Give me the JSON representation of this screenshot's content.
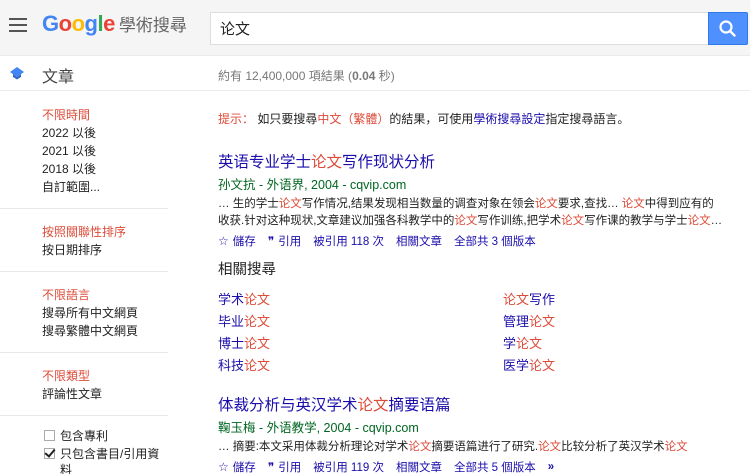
{
  "header": {
    "logo_letters": [
      "G",
      "o",
      "o",
      "g",
      "l",
      "e"
    ],
    "logo_colors": [
      "#4285f4",
      "#ea4335",
      "#fbbc05",
      "#4285f4",
      "#34a853",
      "#ea4335"
    ],
    "product": "學術搜尋",
    "search_value": "论文",
    "search_placeholder": ""
  },
  "subbar": {
    "section": "文章",
    "stats_prefix": "約有 12,400,000 項結果 (",
    "stats_time": "0.04",
    "stats_suffix": " 秒)"
  },
  "sidebar": {
    "time": [
      "不限時間",
      "2022 以後",
      "2021 以後",
      "2018 以後",
      "自訂範圍..."
    ],
    "sort": [
      "按照關聯性排序",
      "按日期排序"
    ],
    "language": [
      "不限語言",
      "搜尋所有中文網頁",
      "搜尋繁體中文網頁"
    ],
    "type": [
      "不限類型",
      "評論性文章"
    ],
    "include_patents": "包含專利",
    "include_citations": "只包含書目/引用資料"
  },
  "tip": {
    "label": "提示：",
    "pre": "如只要搜尋",
    "red": "中文（繁體）",
    "mid": "的結果，可使用",
    "link": "學術搜尋設定",
    "post": "指定搜尋語言。"
  },
  "results": [
    {
      "title_pre": "英语专业学士",
      "title_hl": "论文",
      "title_post": "写作现状分析",
      "meta": "孙文抗 - 外语界, 2004 - cqvip.com",
      "snippet1": [
        "… 生的学士",
        "论文",
        "写作情况,结果发现相当数量的调查对象在领会",
        "论文",
        "要求,查找… ",
        "论文",
        "中得到应有的"
      ],
      "snippet2": [
        "收获.针对这种现状,文章建议加强各科教学中的",
        "论文",
        "写作训练,把学术",
        "论文",
        "写作课的教学与学士",
        "论文",
        "…"
      ],
      "save": "儲存",
      "cite": "引用",
      "cited_by": "被引用 118 次",
      "related": "相關文章",
      "versions": "全部共 3 個版本"
    },
    {
      "title_pre": "体裁分析与英汉学术",
      "title_hl": "论文",
      "title_post": "摘要语篇",
      "meta": "鞠玉梅 - 外语教学, 2004 - cqvip.com",
      "snippet1": [
        "… 摘要:本文采用体裁分析理论对学术",
        "论文",
        "摘要语篇进行了研究.",
        "论文",
        "比较分析了英汉学术",
        "论文",
        ""
      ],
      "snippet2": [],
      "save": "儲存",
      "cite": "引用",
      "cited_by": "被引用 119 次",
      "related": "相關文章",
      "versions": "全部共 5 個版本"
    }
  ],
  "related_searches": {
    "title": "相關搜尋",
    "items": [
      {
        "pre": "学术",
        "hl": "论文",
        "post": ""
      },
      {
        "pre": "",
        "hl": "论文",
        "post": "写作"
      },
      {
        "pre": "毕业",
        "hl": "论文",
        "post": ""
      },
      {
        "pre": "管理",
        "hl": "论文",
        "post": ""
      },
      {
        "pre": "博士",
        "hl": "论文",
        "post": ""
      },
      {
        "pre": "学",
        "hl": "论文",
        "post": ""
      },
      {
        "pre": "科技",
        "hl": "论文",
        "post": ""
      },
      {
        "pre": "医学",
        "hl": "论文",
        "post": ""
      }
    ]
  },
  "colors": {
    "accent_red": "#dd4b39",
    "link_blue": "#1a0dab",
    "green": "#006621",
    "search_button": "#4d90fe"
  },
  "icons": {
    "menu": "hamburger-icon",
    "search": "search-icon",
    "section": "scholar-cap-icon",
    "save": "star-icon",
    "cite": "quote-icon",
    "more": "double-chevron-icon"
  }
}
